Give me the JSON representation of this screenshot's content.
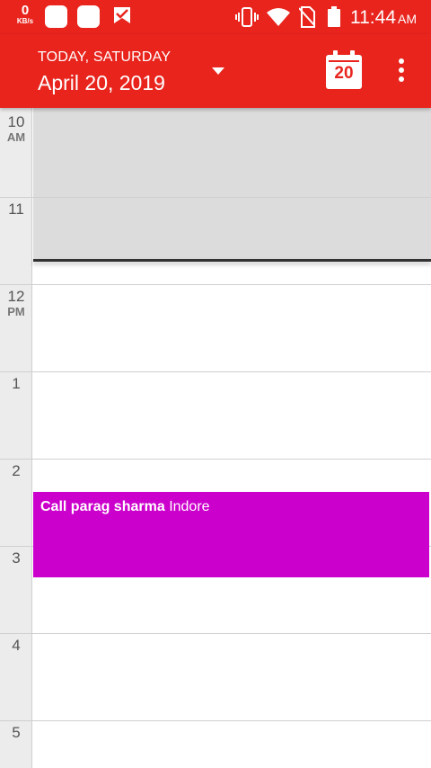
{
  "status_bar": {
    "speed_value": "0",
    "speed_unit": "KB/s",
    "time": "11:44",
    "ampm": "AM",
    "icons": [
      "app-notification-icon",
      "app-notification-icon",
      "check-notification-icon",
      "vibrate-icon",
      "wifi-icon",
      "no-sim-icon",
      "battery-icon"
    ]
  },
  "toolbar": {
    "today_label": "TODAY, SATURDAY",
    "date_label": "April 20, 2019",
    "calendar_day": "20",
    "background": "#e8241d"
  },
  "timeline": {
    "hours": [
      {
        "h": "10",
        "ap": "AM"
      },
      {
        "h": "11",
        "ap": ""
      },
      {
        "h": "12",
        "ap": "PM"
      },
      {
        "h": "1",
        "ap": ""
      },
      {
        "h": "2",
        "ap": ""
      },
      {
        "h": "3",
        "ap": ""
      },
      {
        "h": "4",
        "ap": ""
      },
      {
        "h": "5",
        "ap": ""
      }
    ],
    "events": [
      {
        "title": "Call parag sharma",
        "location": "Indore",
        "color": "#cc00cc"
      }
    ]
  }
}
